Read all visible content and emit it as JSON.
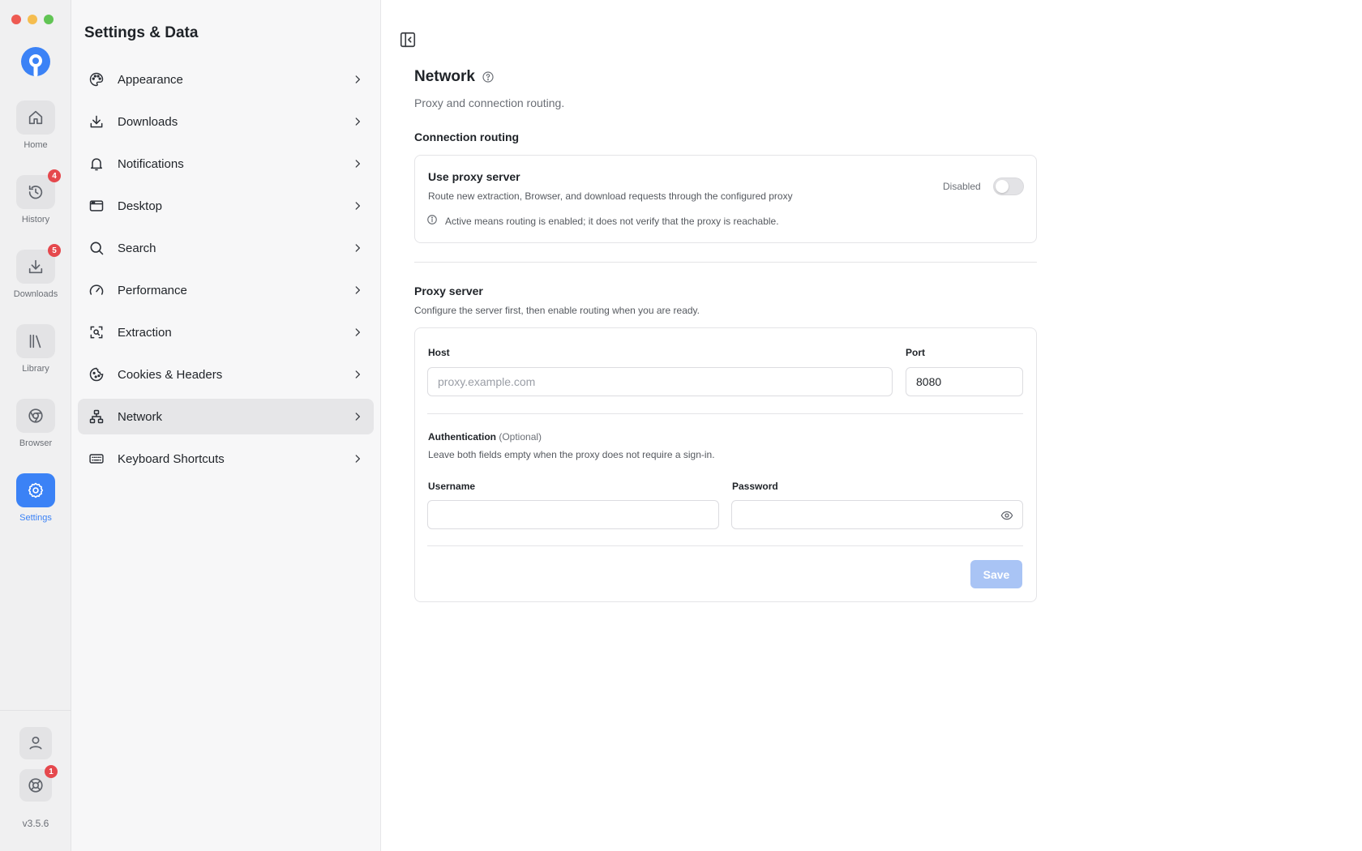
{
  "rail": {
    "items": [
      {
        "label": "Home",
        "icon": "home-icon"
      },
      {
        "label": "History",
        "icon": "history-icon",
        "badge": "4"
      },
      {
        "label": "Downloads",
        "icon": "download-icon",
        "badge": "5"
      },
      {
        "label": "Library",
        "icon": "library-icon"
      },
      {
        "label": "Browser",
        "icon": "chrome-icon"
      },
      {
        "label": "Settings",
        "icon": "gear-icon",
        "active": true
      }
    ],
    "support_badge": "1",
    "version": "v3.5.6"
  },
  "settings_panel": {
    "title": "Settings & Data",
    "items": [
      {
        "label": "Appearance",
        "icon": "palette-icon"
      },
      {
        "label": "Downloads",
        "icon": "download-icon"
      },
      {
        "label": "Notifications",
        "icon": "bell-icon"
      },
      {
        "label": "Desktop",
        "icon": "window-icon"
      },
      {
        "label": "Search",
        "icon": "search-icon"
      },
      {
        "label": "Performance",
        "icon": "gauge-icon"
      },
      {
        "label": "Extraction",
        "icon": "scan-icon"
      },
      {
        "label": "Cookies & Headers",
        "icon": "cookie-icon"
      },
      {
        "label": "Network",
        "icon": "network-icon",
        "active": true
      },
      {
        "label": "Keyboard Shortcuts",
        "icon": "keyboard-icon"
      }
    ]
  },
  "main": {
    "title": "Network",
    "subtitle": "Proxy and connection routing.",
    "routing": {
      "section_title": "Connection routing",
      "heading": "Use proxy server",
      "description": "Route new extraction, Browser, and download requests through the configured proxy",
      "status": "Disabled",
      "note": "Active means routing is enabled; it does not verify that the proxy is reachable."
    },
    "proxy": {
      "section_title": "Proxy server",
      "section_sub": "Configure the server first, then enable routing when you are ready.",
      "host_label": "Host",
      "host_placeholder": "proxy.example.com",
      "host_value": "",
      "port_label": "Port",
      "port_value": "8080",
      "auth_title": "Authentication",
      "auth_optional": "(Optional)",
      "auth_sub": "Leave both fields empty when the proxy does not require a sign-in.",
      "username_label": "Username",
      "username_value": "",
      "password_label": "Password",
      "password_value": "",
      "save_label": "Save"
    }
  },
  "colors": {
    "accent": "#3b82f6",
    "badge": "#e5484d",
    "save_disabled": "#a9c4f5"
  }
}
